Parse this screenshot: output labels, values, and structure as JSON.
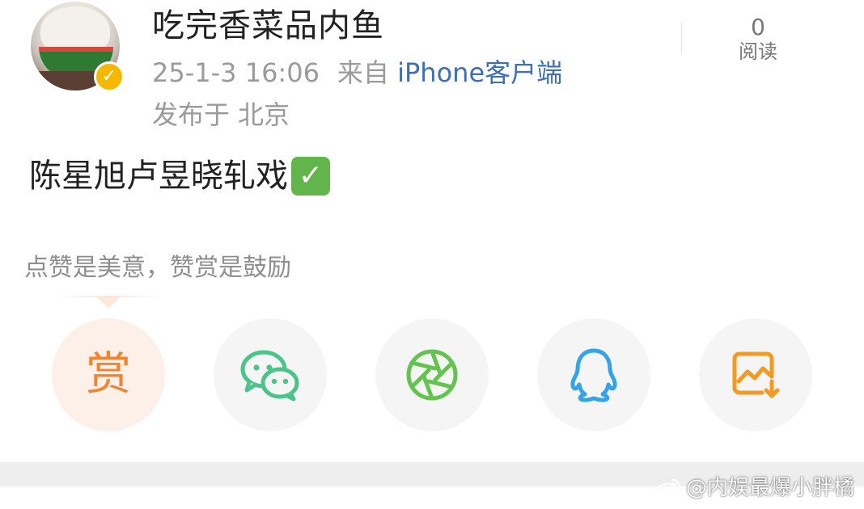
{
  "header": {
    "username": "吃完香菜品内鱼",
    "date_time": "25-1-3 16:06",
    "from_label": "来自",
    "client": "iPhone客户端",
    "location_prefix": "发布于",
    "location": "北京",
    "avatar": {
      "icon": "avatar-photo",
      "verified_icon": "verified-badge-icon",
      "verified_color": "#f5b800"
    }
  },
  "stats": {
    "read_count": "0",
    "read_label": "阅读"
  },
  "post": {
    "text": "陈星旭卢昱晓轧戏",
    "emoji_icon": "white-check-mark-icon",
    "emoji_glyph": "✓"
  },
  "reward_tip": {
    "text": "点赞是美意，赞赏是鼓励"
  },
  "share_buttons": [
    {
      "name": "reward",
      "icon": "reward-icon",
      "glyph": "赏",
      "color": "#ef8532"
    },
    {
      "name": "wechat",
      "icon": "wechat-icon",
      "color": "#4cc38a"
    },
    {
      "name": "moments",
      "icon": "wechat-moments-icon",
      "color": "#62c34f"
    },
    {
      "name": "qq",
      "icon": "qq-icon",
      "color": "#35a3e8"
    },
    {
      "name": "save-image",
      "icon": "save-image-icon",
      "color": "#f39a22"
    }
  ],
  "watermark": {
    "text": "@内娱最爆小胖橘",
    "icon": "weibo-logo-icon"
  },
  "colors": {
    "link": "#3d6fb2",
    "meta_gray": "#9a9a9a",
    "reward_bg": "#fdf0e8"
  }
}
